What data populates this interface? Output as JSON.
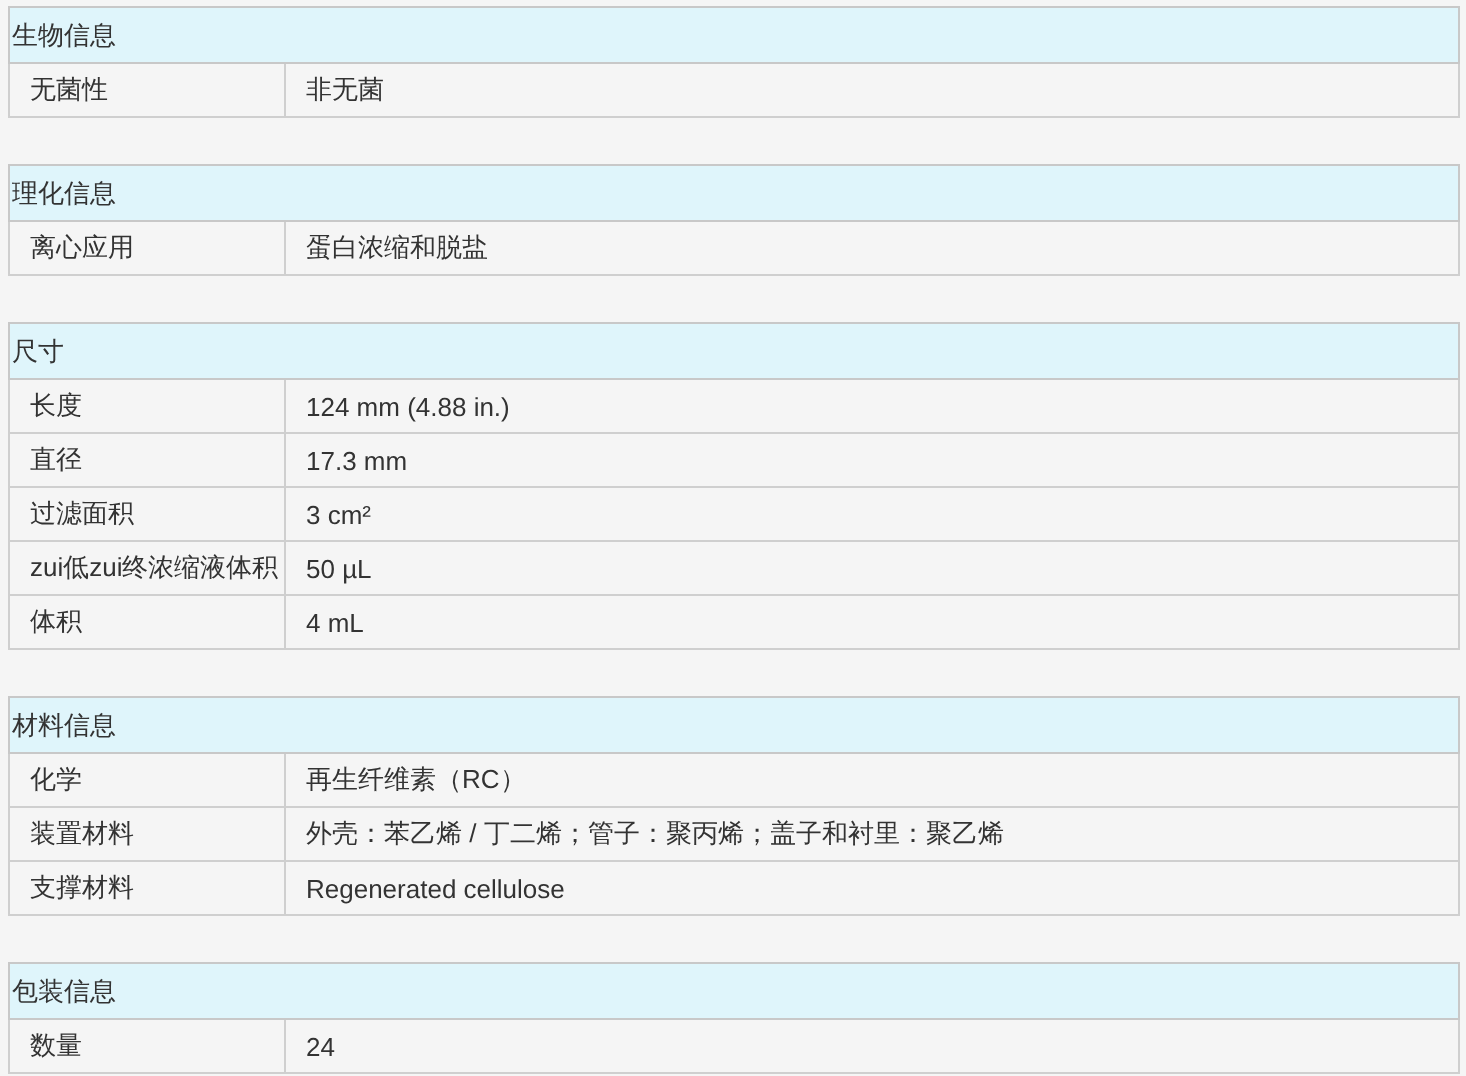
{
  "sections": [
    {
      "title": "生物信息",
      "rows": [
        {
          "label": "无菌性",
          "value": "非无菌"
        }
      ]
    },
    {
      "title": "理化信息",
      "rows": [
        {
          "label": "离心应用",
          "value": "蛋白浓缩和脱盐"
        }
      ]
    },
    {
      "title": "尺寸",
      "rows": [
        {
          "label": "长度",
          "value": "124 mm (4.88 in.)"
        },
        {
          "label": "直径",
          "value": "17.3 mm"
        },
        {
          "label": "过滤面积",
          "value": "3 cm²"
        },
        {
          "label": "zui低zui终浓缩液体积",
          "value": "50 µL"
        },
        {
          "label": "体积",
          "value": "4 mL"
        }
      ]
    },
    {
      "title": "材料信息",
      "rows": [
        {
          "label": "化学",
          "value": "再生纤维素（RC）"
        },
        {
          "label": "装置材料",
          "value": "外壳：苯乙烯 / 丁二烯；管子：聚丙烯；盖子和衬里：聚乙烯"
        },
        {
          "label": "支撑材料",
          "value": "Regenerated cellulose"
        }
      ]
    },
    {
      "title": "包装信息",
      "rows": [
        {
          "label": "数量",
          "value": "24"
        }
      ]
    }
  ]
}
